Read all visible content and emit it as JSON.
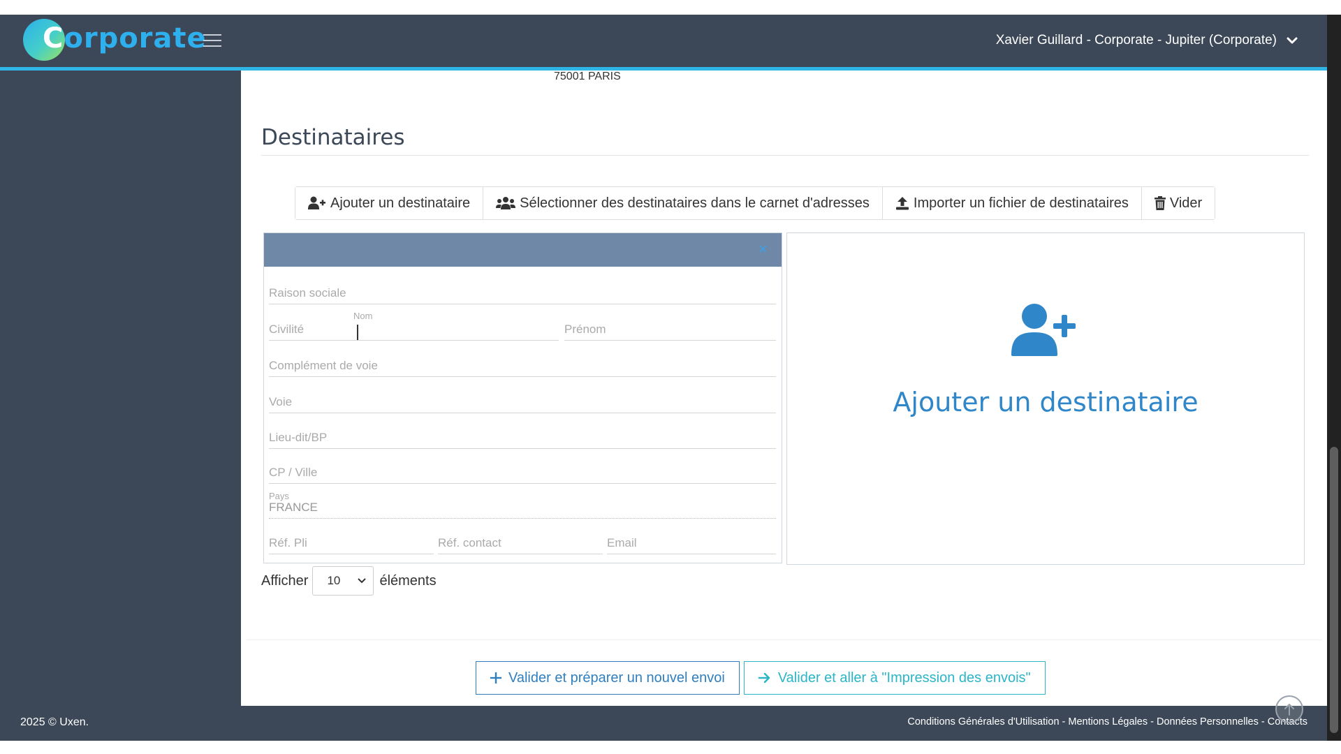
{
  "colors": {
    "header_bg": "#3c4858",
    "accent_line": "#2fb5e6",
    "form_header_bg": "#7088a8",
    "primary_blue": "#2f7fc0",
    "teal": "#2bb5c6"
  },
  "header": {
    "logo_first_letter": "C",
    "logo_rest": "orporate",
    "user_label": "Xavier Guillard - Corporate - Jupiter (Corporate)",
    "menu_icon": "hamburger-icon",
    "dropdown_icon": "chevron-down-icon"
  },
  "main": {
    "address_line": "75001 PARIS",
    "section_title": "Destinataires",
    "toolbar": [
      {
        "icon": "user-plus-icon",
        "label": "Ajouter un destinataire"
      },
      {
        "icon": "users-icon",
        "label": "Sélectionner des destinataires dans le carnet d'adresses"
      },
      {
        "icon": "upload-icon",
        "label": "Importer un fichier de destinataires"
      },
      {
        "icon": "trash-icon",
        "label": "Vider"
      }
    ],
    "form": {
      "close_glyph": "×",
      "raison_sociale": "Raison sociale",
      "civilite": "Civilité",
      "nom_label": "Nom",
      "prenom": "Prénom",
      "complement_voie": "Complément de voie",
      "voie": "Voie",
      "lieu_dit": "Lieu-dit/BP",
      "cp_ville": "CP / Ville",
      "pays_label": "Pays",
      "pays_value": "FRANCE",
      "ref_pli": "Réf. Pli",
      "ref_contact": "Réf. contact",
      "email": "Email"
    },
    "add_card": {
      "icon": "user-plus-icon",
      "label": "Ajouter un destinataire"
    },
    "length": {
      "prefix": "Afficher",
      "value": "10",
      "suffix": "éléments"
    },
    "actions": [
      {
        "icon": "plus-icon",
        "label": "Valider et préparer un nouvel envoi"
      },
      {
        "icon": "arrow-right-icon",
        "label": "Valider et aller à \"Impression des envois\""
      }
    ]
  },
  "footer": {
    "copyright": "2025 © Uxen.",
    "links": [
      "Conditions Générales d'Utilisation",
      "Mentions Légales",
      "Données Personnelles",
      "Contacts"
    ],
    "separator": " - "
  }
}
